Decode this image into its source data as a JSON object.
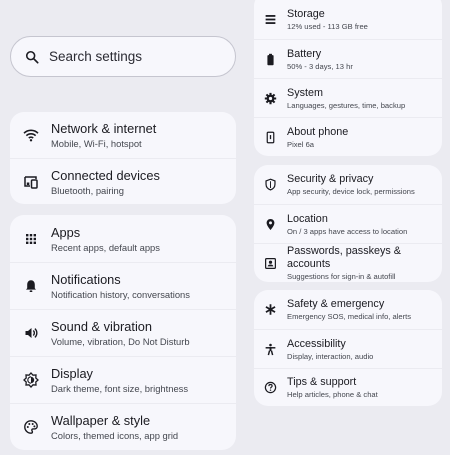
{
  "search": {
    "placeholder": "Search settings"
  },
  "left_groups": [
    {
      "items": [
        {
          "icon": "wifi-icon",
          "title": "Network & internet",
          "subtitle": "Mobile, Wi-Fi, hotspot"
        },
        {
          "icon": "connected-devices-icon",
          "title": "Connected devices",
          "subtitle": "Bluetooth, pairing"
        }
      ]
    },
    {
      "items": [
        {
          "icon": "apps-grid-icon",
          "title": "Apps",
          "subtitle": "Recent apps, default apps"
        },
        {
          "icon": "bell-icon",
          "title": "Notifications",
          "subtitle": "Notification history, conversations"
        },
        {
          "icon": "speaker-icon",
          "title": "Sound & vibration",
          "subtitle": "Volume, vibration, Do Not Disturb"
        },
        {
          "icon": "brightness-icon",
          "title": "Display",
          "subtitle": "Dark theme, font size, brightness"
        },
        {
          "icon": "palette-icon",
          "title": "Wallpaper & style",
          "subtitle": "Colors, themed icons, app grid"
        }
      ]
    }
  ],
  "right_groups": [
    {
      "items": [
        {
          "icon": "storage-icon",
          "title": "Storage",
          "subtitle": "12% used - 113 GB free"
        },
        {
          "icon": "battery-icon",
          "title": "Battery",
          "subtitle": "50% - 3 days, 13 hr"
        },
        {
          "icon": "gear-icon",
          "title": "System",
          "subtitle": "Languages, gestures, time, backup"
        },
        {
          "icon": "phone-info-icon",
          "title": "About phone",
          "subtitle": "Pixel 6a"
        }
      ]
    },
    {
      "items": [
        {
          "icon": "shield-icon",
          "title": "Security & privacy",
          "subtitle": "App security, device lock, permissions"
        },
        {
          "icon": "location-pin-icon",
          "title": "Location",
          "subtitle": "On / 3 apps have access to location"
        },
        {
          "icon": "account-box-icon",
          "title": "Passwords, passkeys & accounts",
          "subtitle": "Suggestions for sign-in & autofill"
        }
      ]
    },
    {
      "items": [
        {
          "icon": "emergency-asterisk-icon",
          "title": "Safety & emergency",
          "subtitle": "Emergency SOS, medical info, alerts"
        },
        {
          "icon": "accessibility-icon",
          "title": "Accessibility",
          "subtitle": "Display, interaction, audio"
        },
        {
          "icon": "help-icon",
          "title": "Tips & support",
          "subtitle": "Help articles, phone & chat"
        }
      ]
    }
  ],
  "colors": {
    "background": "#ebebf1",
    "card": "#f7f7fc",
    "text": "#1b1b21",
    "subtext": "#44474f"
  }
}
